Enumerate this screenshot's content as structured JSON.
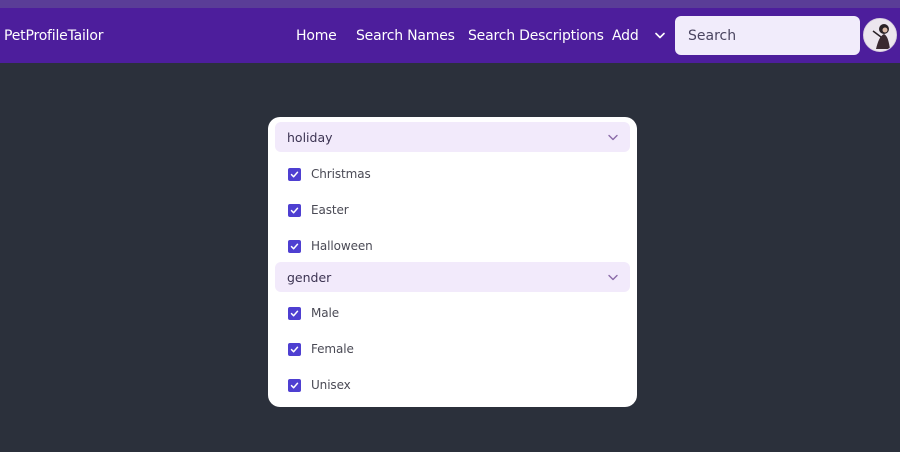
{
  "nav": {
    "brand": "PetProfileTailor",
    "links": [
      "Home",
      "Search Names",
      "Search Descriptions",
      "Add"
    ],
    "search_placeholder": "Search"
  },
  "filters": {
    "groups": [
      {
        "title": "holiday",
        "options": [
          {
            "label": "Christmas",
            "checked": true
          },
          {
            "label": "Easter",
            "checked": true
          },
          {
            "label": "Halloween",
            "checked": true
          }
        ]
      },
      {
        "title": "gender",
        "options": [
          {
            "label": "Male",
            "checked": true
          },
          {
            "label": "Female",
            "checked": true
          },
          {
            "label": "Unisex",
            "checked": true
          }
        ]
      }
    ]
  },
  "colors": {
    "navbar": "#4d1e9c",
    "accent": "#4e3fd1",
    "group_header_bg": "#f2eafb",
    "page_bg": "#2b303b"
  },
  "icons": {
    "chevron": "chevron-down-icon",
    "check": "check-icon",
    "avatar": "user-avatar"
  }
}
